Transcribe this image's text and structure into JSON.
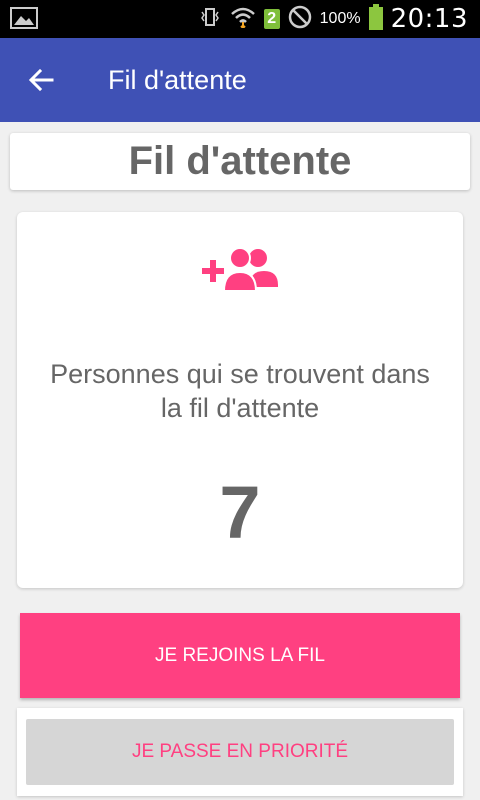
{
  "status_bar": {
    "time": "20:13",
    "battery_percent": "100%",
    "sim_slot": "2",
    "icons": [
      "gallery-icon",
      "vibrate-icon",
      "wifi-icon",
      "sim-icon",
      "do-not-disturb-icon",
      "battery-icon"
    ]
  },
  "app_bar": {
    "title": "Fil d'attente",
    "back_icon": "arrow-back-icon"
  },
  "header": {
    "title": "Fil d'attente"
  },
  "queue": {
    "icon": "group-add-icon",
    "description": "Personnes qui se trouvent dans la fil d'attente",
    "count": "7"
  },
  "actions": {
    "join_label": "JE REJOINS LA FIL",
    "priority_label": "JE PASSE EN PRIORITÉ"
  },
  "colors": {
    "primary": "#3f51b5",
    "accent": "#ff4081",
    "text_gray": "#666666"
  }
}
